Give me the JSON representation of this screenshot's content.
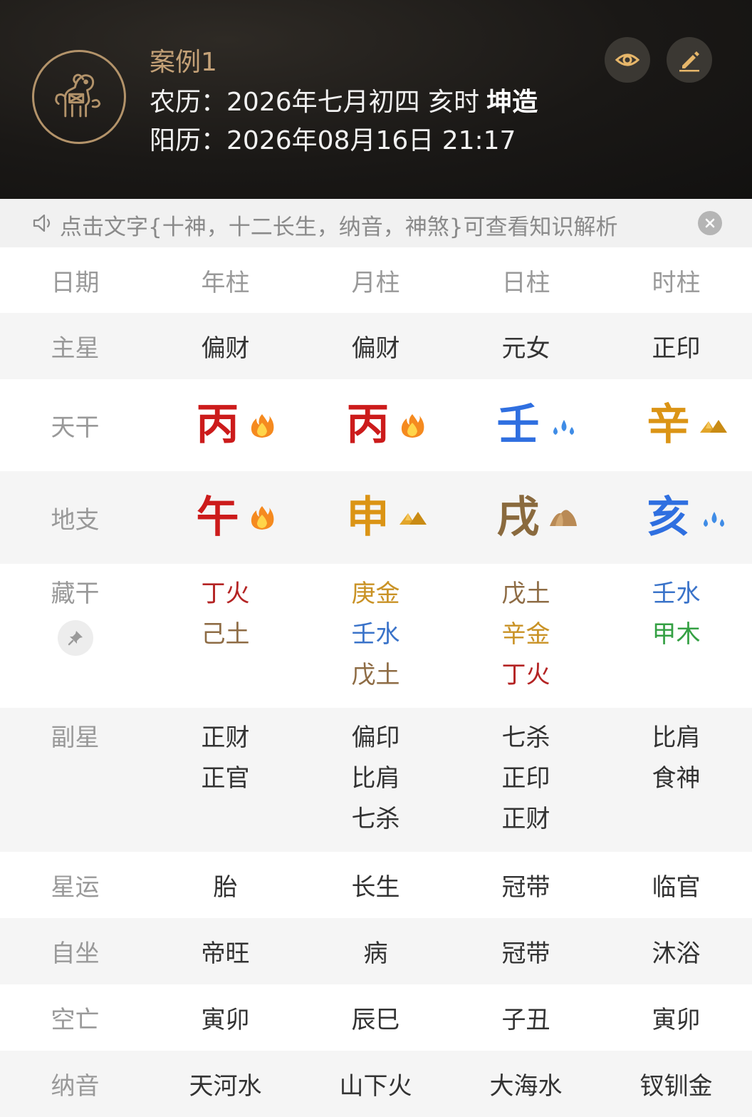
{
  "header": {
    "title": "案例1",
    "lunar_label": "农历：",
    "lunar_value": "2026年七月初四 亥时",
    "lunar_gender": "坤造",
    "solar_label": "阳历：",
    "solar_value": "2026年08月16日 21:17"
  },
  "notice": {
    "text": "点击文字{十神，十二长生，纳音，神煞}可查看知识解析"
  },
  "table": {
    "labels": {
      "date": "日期",
      "main_star": "主星",
      "stem": "天干",
      "branch": "地支",
      "hidden": "藏干",
      "sub_star": "副星",
      "star_luck": "星运",
      "self_sit": "自坐",
      "void": "空亡",
      "nayin": "纳音"
    },
    "columns": [
      "年柱",
      "月柱",
      "日柱",
      "时柱"
    ],
    "main_star": [
      "偏财",
      "偏财",
      "元女",
      "正印"
    ],
    "stems": [
      {
        "char": "丙",
        "element": "fire",
        "icon": "fire-icon"
      },
      {
        "char": "丙",
        "element": "fire",
        "icon": "fire-icon"
      },
      {
        "char": "壬",
        "element": "water",
        "icon": "water-icon"
      },
      {
        "char": "辛",
        "element": "metal",
        "icon": "metal-icon"
      }
    ],
    "branches": [
      {
        "char": "午",
        "element": "fire",
        "icon": "fire-icon"
      },
      {
        "char": "申",
        "element": "metal",
        "icon": "metal-icon"
      },
      {
        "char": "戌",
        "element": "earth",
        "icon": "earth-icon"
      },
      {
        "char": "亥",
        "element": "water",
        "icon": "water-icon"
      }
    ],
    "hidden_stems": [
      [
        {
          "text": "丁火",
          "element": "fire"
        },
        {
          "text": "己土",
          "element": "earth"
        }
      ],
      [
        {
          "text": "庚金",
          "element": "metal"
        },
        {
          "text": "壬水",
          "element": "water"
        },
        {
          "text": "戊土",
          "element": "earth"
        }
      ],
      [
        {
          "text": "戊土",
          "element": "earth"
        },
        {
          "text": "辛金",
          "element": "metal"
        },
        {
          "text": "丁火",
          "element": "fire"
        }
      ],
      [
        {
          "text": "壬水",
          "element": "water"
        },
        {
          "text": "甲木",
          "element": "wood"
        }
      ]
    ],
    "sub_stars": [
      [
        "正财",
        "正官"
      ],
      [
        "偏印",
        "比肩",
        "七杀"
      ],
      [
        "七杀",
        "正印",
        "正财"
      ],
      [
        "比肩",
        "食神"
      ]
    ],
    "star_luck": [
      "胎",
      "长生",
      "冠带",
      "临官"
    ],
    "self_sit": [
      "帝旺",
      "病",
      "冠带",
      "沐浴"
    ],
    "void": [
      "寅卯",
      "辰巳",
      "子丑",
      "寅卯"
    ],
    "nayin": [
      "天河水",
      "山下火",
      "大海水",
      "钗钏金"
    ]
  },
  "colors": {
    "fire": "#cc1b1b",
    "metal": "#db9415",
    "water": "#2f6fe0",
    "earth": "#8a6a3e",
    "wood": "#2e9b3c",
    "header_accent": "#c4a177"
  }
}
